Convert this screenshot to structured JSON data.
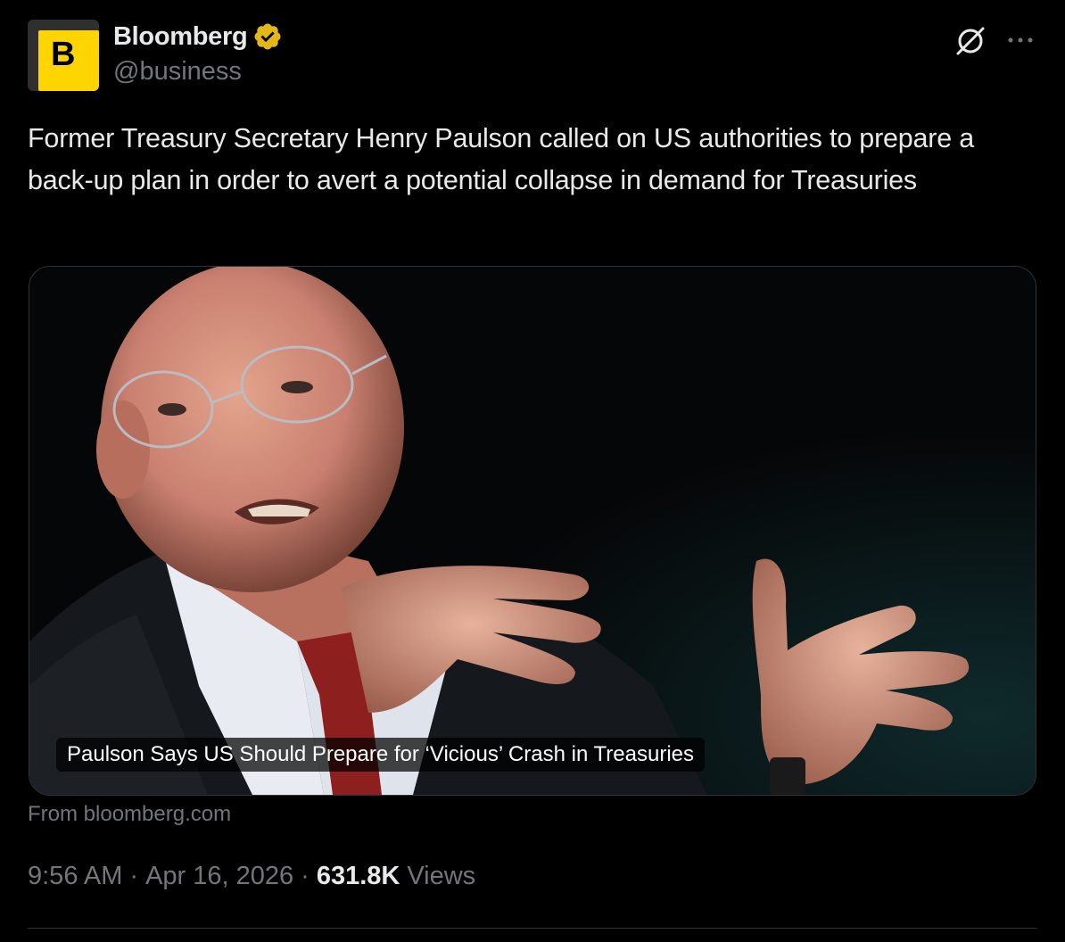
{
  "author": {
    "display_name": "Bloomberg",
    "handle": "@business",
    "avatar_letter": "B",
    "avatar_color": "#ffd500",
    "verified": true,
    "verified_color": "#e2b719"
  },
  "header": {
    "grok_icon": "grok-slash-circle-icon",
    "more_icon": "more-horizontal-icon"
  },
  "tweet": {
    "text": "Former Treasury Secretary Henry Paulson called on US authorities to prepare a back-up plan in order to avert a potential collapse in demand for Treasuries"
  },
  "card": {
    "caption": "Paulson Says US Should Prepare for ‘Vicious’ Crash in Treasuries",
    "source": "From bloomberg.com"
  },
  "meta": {
    "time": "9:56 AM",
    "separator": "·",
    "date": "Apr 16, 2026",
    "views_count": "631.8K",
    "views_label": "Views"
  },
  "colors": {
    "background": "#000000",
    "text_primary": "#e7e9ea",
    "text_secondary": "#71767b",
    "border": "#2f3336"
  }
}
